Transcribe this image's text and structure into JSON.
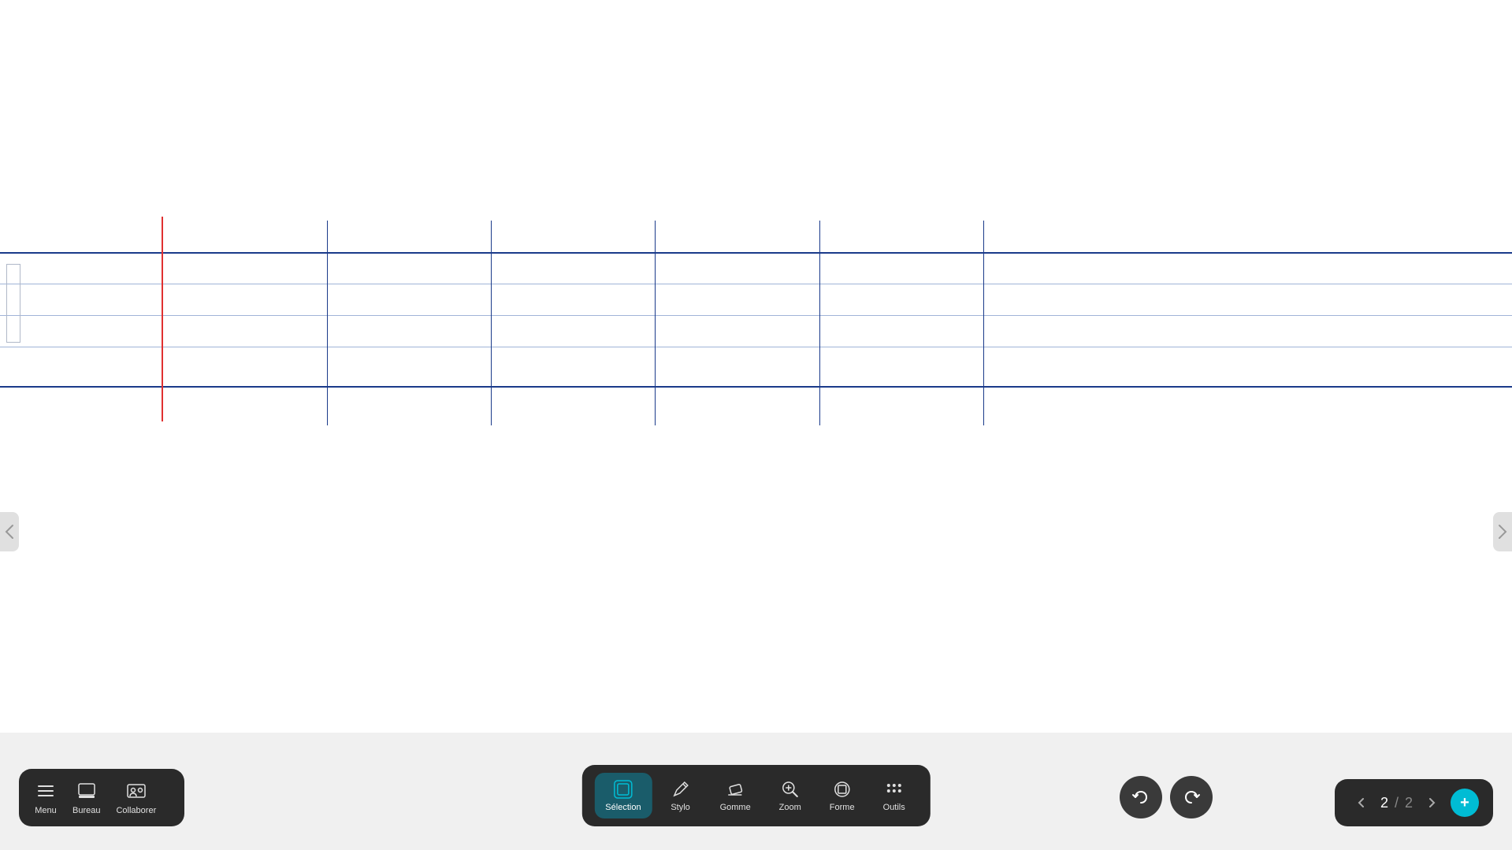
{
  "toolbar_left": {
    "menu_label": "Menu",
    "bureau_label": "Bureau",
    "collaborer_label": "Collaborer"
  },
  "toolbar_center": {
    "selection_label": "Sélection",
    "stylo_label": "Stylo",
    "gomme_label": "Gomme",
    "zoom_label": "Zoom",
    "forme_label": "Forme",
    "outils_label": "Outils",
    "active_tool": "selection"
  },
  "page_navigation": {
    "current_page": "2",
    "separator": "/",
    "total_pages": "2",
    "add_label": "+"
  },
  "canvas": {
    "grid_color": "#1a3a8a",
    "red_line_color": "#e03030"
  }
}
